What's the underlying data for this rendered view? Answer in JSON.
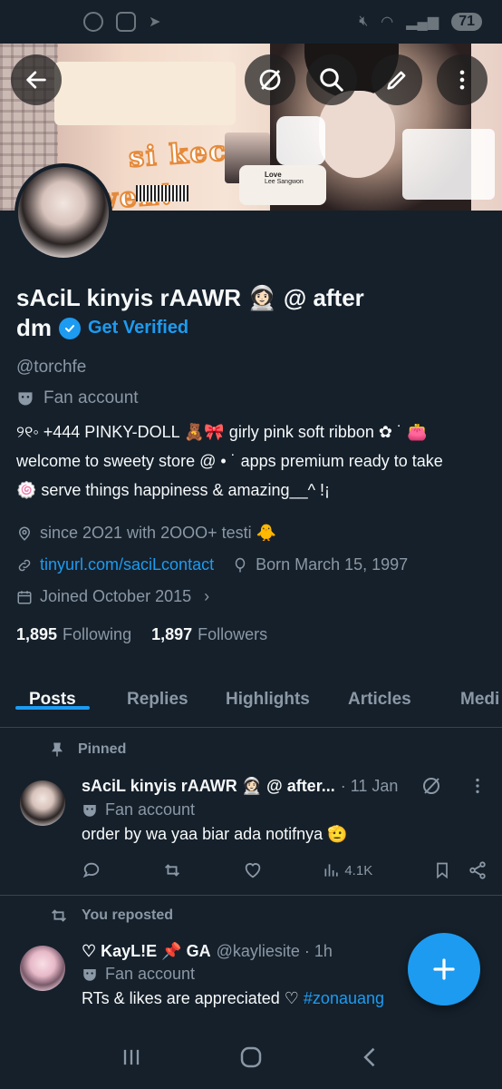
{
  "status_bar": {
    "left_icons": [
      "whatsapp-icon",
      "screenshot-icon",
      "telegram-icon"
    ],
    "right_icons": [
      "mute-icon",
      "wifi-icon",
      "signal-icon"
    ],
    "battery": "71"
  },
  "banner": {
    "script_line1": "si kecil",
    "script_line2": "wen!",
    "music_title": "Love",
    "music_artist": "Lee Sangwon"
  },
  "header_buttons": [
    "back-icon",
    "grok-icon",
    "search-icon",
    "edit-icon",
    "more-icon"
  ],
  "profile": {
    "name_line1": "sAciL kinyis rAAWR 👩🏻‍🚀 @ after",
    "name_line2": "dm",
    "get_verified": "Get Verified",
    "handle": "@torchfe",
    "category": "Fan account",
    "bio_line1": "୨୧◦ +444 PINKY-DOLL 🧸🎀 girly pink soft ribbon ✿ ˙ 👛",
    "bio_line2": "welcome to sweety store @ • ˙ apps premium ready to take",
    "bio_line3": "🍥 serve things happiness & amazing__^ !¡",
    "location": "since 2O21 with 2OOO+ testi 🐥",
    "link": "tinyurl.com/saciLcontact",
    "birthday": "Born March 15, 1997",
    "joined": "Joined October 2015",
    "following_count": "1,895",
    "following_label": "Following",
    "followers_count": "1,897",
    "followers_label": "Followers"
  },
  "tabs": [
    {
      "label": "Posts",
      "active": true
    },
    {
      "label": "Replies",
      "active": false
    },
    {
      "label": "Highlights",
      "active": false
    },
    {
      "label": "Articles",
      "active": false
    },
    {
      "label": "Medi",
      "active": false
    }
  ],
  "posts": [
    {
      "social_label": "Pinned",
      "name": "sAciL kinyis rAAWR 👩🏻‍🚀 @ after...",
      "time": "· 11 Jan",
      "category": "Fan account",
      "text": "order by wa yaa biar ada notifnya 🫡",
      "views": "4.1K"
    },
    {
      "social_label": "You reposted",
      "name": "♡ KayL!E 📌 GA",
      "handle_time": "@kayliesite · 1h",
      "category": "Fan account",
      "text": "RTs & likes are appreciated ♡ ",
      "hashtag": "#zonauang"
    }
  ],
  "colors": {
    "background": "#15202b",
    "accent": "#1d9bf0",
    "secondary_text": "#8b98a5",
    "divider": "#38444d"
  }
}
